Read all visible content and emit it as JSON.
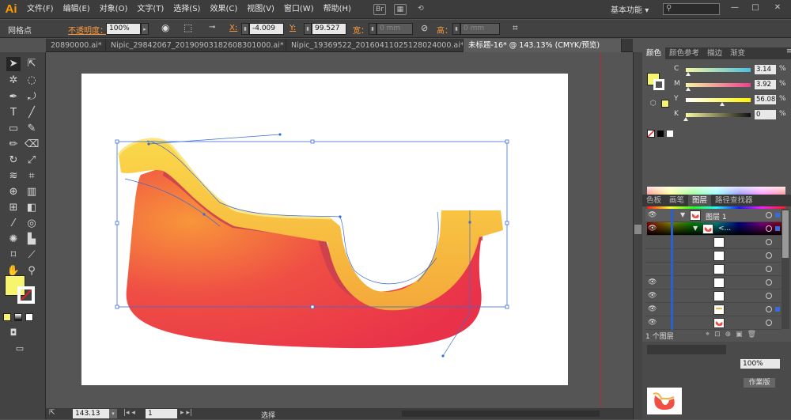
{
  "app": {
    "logo": "Ai"
  },
  "menu": [
    "文件(F)",
    "编辑(E)",
    "对象(O)",
    "文字(T)",
    "选择(S)",
    "效果(C)",
    "视图(V)",
    "窗口(W)",
    "帮助(H)"
  ],
  "workspace_label": "基本功能",
  "control": {
    "mode": "网格点",
    "opacity_label": "不透明度：",
    "opacity_value": "100%",
    "x_label": "X:",
    "x_value": "-4.009",
    "y_label": "Y:",
    "y_value": "99.527",
    "w_label": "宽：",
    "w_value": "0 mm",
    "h_label": "高：",
    "h_value": "0 mm"
  },
  "tabs": [
    "20890000.ai*",
    "Nipic_29842067_20190903182608301000.ai*",
    "Nipic_19369522_20160411025128024000.ai*",
    "未标题-16* @ 143.13% (CMYK/预览)"
  ],
  "active_tab_index": 3,
  "color_panel": {
    "tabs": [
      "颜色",
      "颜色参考",
      "描边",
      "渐变"
    ],
    "channels": [
      {
        "label": "C",
        "value": "3.14",
        "pct": 3.14,
        "grad": [
          "#f5f5a0",
          "#4ac0e0"
        ]
      },
      {
        "label": "M",
        "value": "3.92",
        "pct": 3.92,
        "grad": [
          "#f5f5a0",
          "#ee3d8f"
        ]
      },
      {
        "label": "Y",
        "value": "56.08",
        "pct": 56.08,
        "grad": [
          "#ffffff",
          "#fff200"
        ]
      },
      {
        "label": "K",
        "value": "0",
        "pct": 0,
        "grad": [
          "#f8f8a0",
          "#111111"
        ]
      }
    ],
    "unit": "%",
    "fill_color": "#f7f46e"
  },
  "layers_panel": {
    "tabs": [
      "色板",
      "画笔",
      "图层",
      "路径查找器"
    ],
    "rows": [
      {
        "name": "图层 1"
      },
      {
        "name": "<..."
      },
      {
        "name": ""
      },
      {
        "name": ""
      },
      {
        "name": ""
      },
      {
        "name": ""
      },
      {
        "name": ""
      },
      {
        "name": ""
      },
      {
        "name": ""
      }
    ],
    "footer": "1 个图层"
  },
  "lower_panel": {
    "zoom": "100%",
    "button": "作業版"
  },
  "status": {
    "zoom": "143.13",
    "page": "1",
    "tool": "选择"
  },
  "colors": {
    "accent": "#ff9a00",
    "selection_blue": "#3a6bd6",
    "sled_red": "#ec3a45",
    "sled_orange": "#f7a03c",
    "sled_yellow": "#f9c93b"
  }
}
